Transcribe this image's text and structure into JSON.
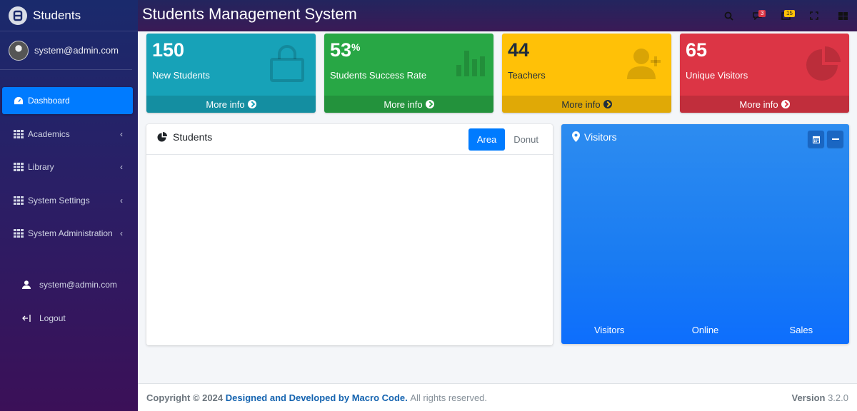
{
  "brand": {
    "name": "Students"
  },
  "user": {
    "email": "system@admin.com"
  },
  "nav": [
    {
      "label": "Dashboard",
      "icon": "dashboard-icon",
      "active": true
    },
    {
      "label": "Academics",
      "icon": "grid-icon"
    },
    {
      "label": "Library",
      "icon": "grid-icon"
    },
    {
      "label": "System Settings",
      "icon": "grid-icon"
    },
    {
      "label": "System Administration",
      "icon": "grid-icon"
    }
  ],
  "nav_bottom": [
    {
      "label": "system@admin.com",
      "icon": "user-icon"
    },
    {
      "label": "Logout",
      "icon": "logout-icon"
    }
  ],
  "header": {
    "title": "Students Management System",
    "notifications_count": "3",
    "messages_count": "15"
  },
  "stats": [
    {
      "value": "150",
      "suffix": "",
      "label": "New Students",
      "footer": "More info",
      "color": "#17a2b8",
      "icon": "shopping-bag-icon"
    },
    {
      "value": "53",
      "suffix": "%",
      "label": "Students Success Rate",
      "footer": "More info",
      "color": "#28a745",
      "icon": "bar-chart-icon"
    },
    {
      "value": "44",
      "suffix": "",
      "label": "Teachers",
      "footer": "More info",
      "color": "#ffc107",
      "icon": "user-plus-icon"
    },
    {
      "value": "65",
      "suffix": "",
      "label": "Unique Visitors",
      "footer": "More info",
      "color": "#dc3545",
      "icon": "pie-chart-icon"
    }
  ],
  "students_card": {
    "title": "Students",
    "tabs": [
      "Area",
      "Donut"
    ],
    "active_tab": "Area"
  },
  "visitors_card": {
    "title": "Visitors",
    "footer": [
      "Visitors",
      "Online",
      "Sales"
    ]
  },
  "footer": {
    "copyright": "Copyright © 2024",
    "developer": "Designed and Developed by Macro Code.",
    "rights": "All rights reserved.",
    "version_label": "Version",
    "version": "3.2.0"
  }
}
